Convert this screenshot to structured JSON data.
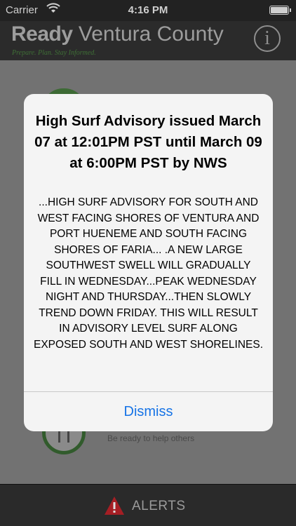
{
  "status_bar": {
    "carrier": "Carrier",
    "time": "4:16 PM"
  },
  "nav": {
    "brand_bold": "Ready",
    "brand_rest": "Ventura County",
    "tagline": "Prepare. Plan. Stay Informed.",
    "info_glyph": "i"
  },
  "background": {
    "row_label": "Be ready to help others"
  },
  "alert_dialog": {
    "title": "High Surf Advisory issued March 07 at 12:01PM PST until March 09 at 6:00PM PST by NWS",
    "message": "...HIGH SURF ADVISORY FOR SOUTH AND WEST FACING SHORES OF VENTURA AND PORT HUENEME AND SOUTH FACING SHORES OF FARIA... .A NEW LARGE SOUTHWEST SWELL WILL GRADUALLY FILL IN WEDNESDAY...PEAK WEDNESDAY NIGHT AND THURSDAY...THEN SLOWLY TREND DOWN FRIDAY. THIS WILL RESULT IN ADVISORY LEVEL SURF ALONG EXPOSED SOUTH AND WEST SHORELINES.",
    "dismiss_label": "Dismiss"
  },
  "alerts_bar": {
    "label": "ALERTS"
  },
  "colors": {
    "accent": "#1673e6",
    "warning": "#c0232b",
    "brand_green": "#3f6f36"
  }
}
